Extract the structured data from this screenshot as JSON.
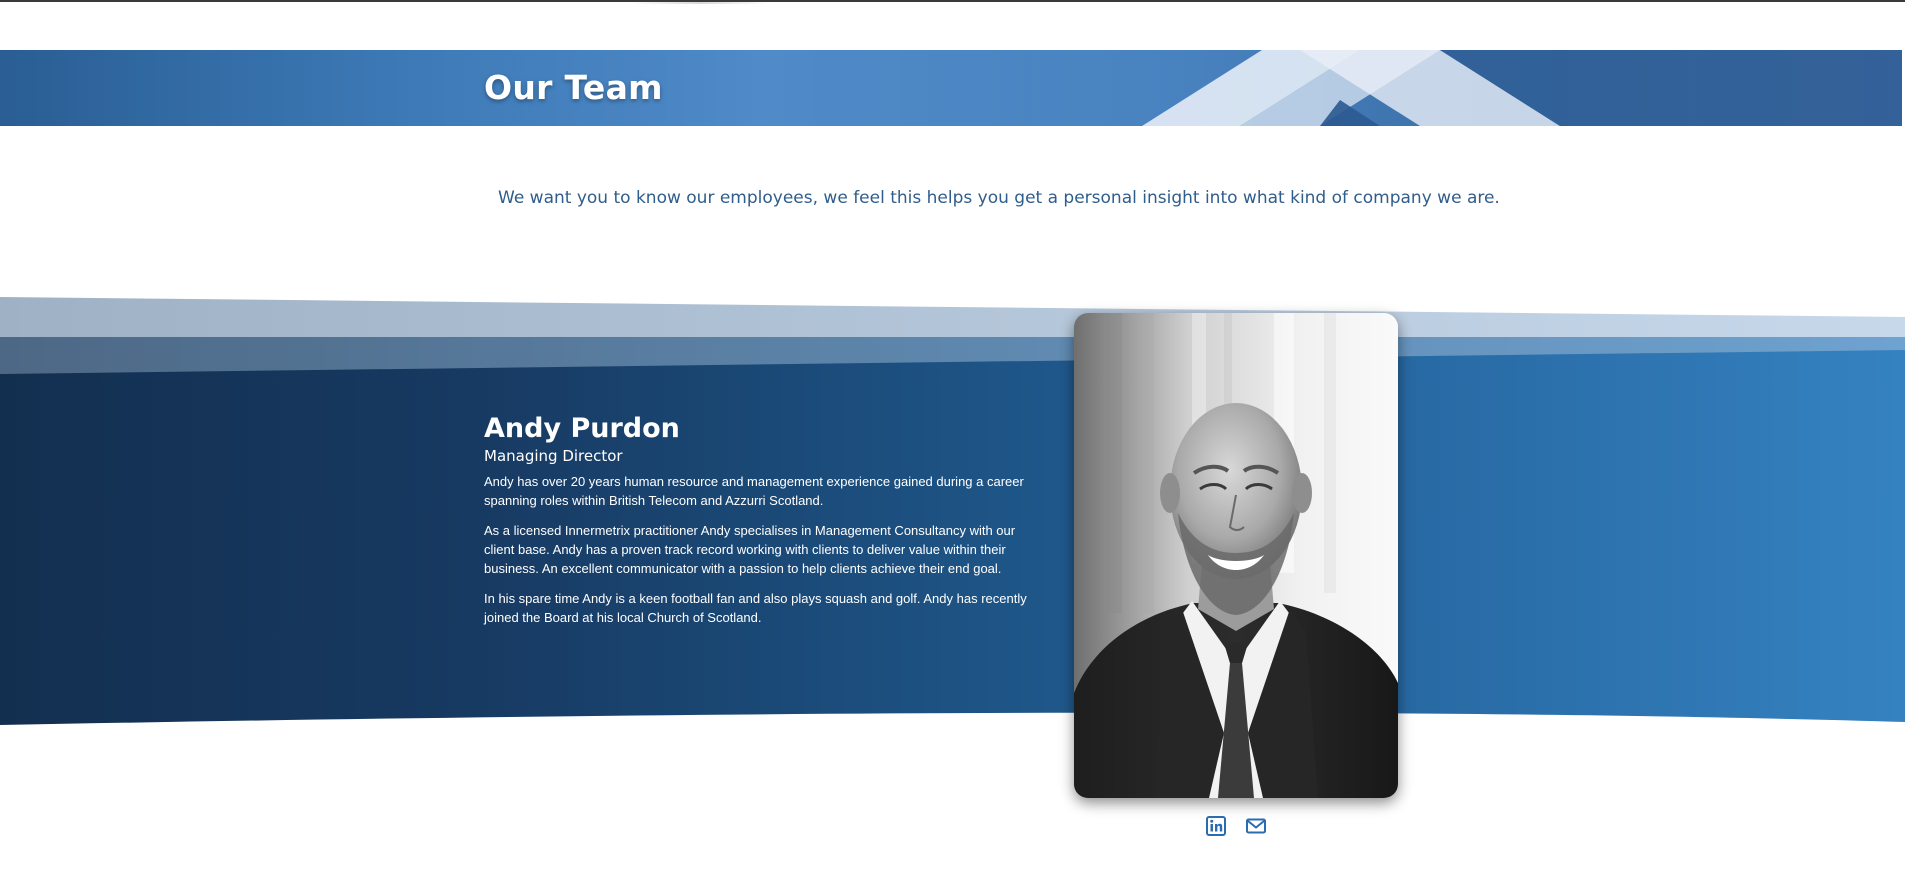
{
  "banner": {
    "title": "Our Team"
  },
  "intro": {
    "text": "We want you to know our employees, we feel this helps you get a personal insight into what kind of company we are."
  },
  "member": {
    "name": "Andy Purdon",
    "role": "Managing Director",
    "bio": [
      "Andy has over 20 years human resource and management experience gained during a career spanning roles within British Telecom and Azzurri Scotland.",
      "As a licensed Innermetrix practitioner Andy specialises in Management Consultancy with our client base. Andy has a proven track record working with clients to deliver value within their business. An excellent communicator with a passion to help clients achieve their end goal.",
      "In his spare time Andy is a keen football fan and also plays squash and golf. Andy has recently joined the Board at his local Church of Scotland."
    ],
    "photo_alt": "Portrait of Andy Purdon",
    "social": [
      {
        "icon": "linkedin-icon"
      },
      {
        "icon": "mail-icon"
      }
    ]
  },
  "colors": {
    "banner_blue": "#4a86c6",
    "navy": "#16345a",
    "accent_blue": "#3582c1",
    "intro_text": "#2f5d8c",
    "icon_blue": "#2b6cb0"
  }
}
